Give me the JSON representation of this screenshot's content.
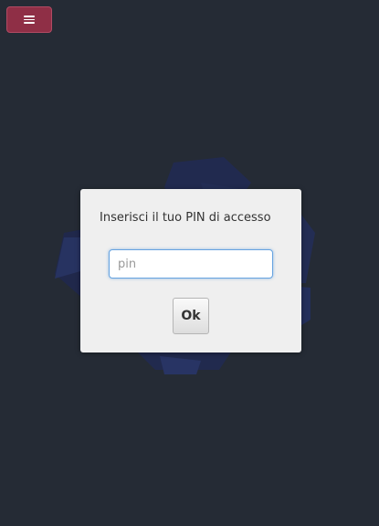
{
  "header": {
    "menu_icon": "hamburger-icon",
    "menu_color": "#8f2f46"
  },
  "background": {
    "color": "#252b35",
    "logo": "dark-blue-cube-logo"
  },
  "dialog": {
    "title": "Inserisci il tuo PIN di accesso",
    "pin_placeholder": "pin",
    "pin_value": "",
    "ok_label": "Ok"
  }
}
